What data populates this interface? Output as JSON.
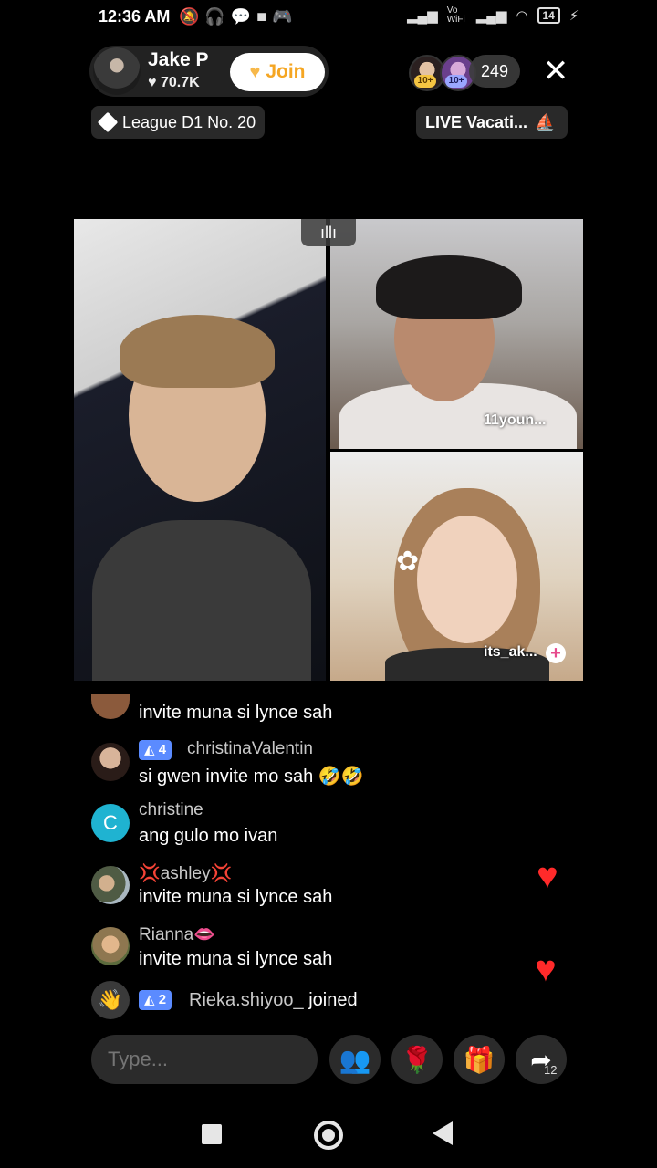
{
  "status_bar": {
    "time": "12:36 AM",
    "network_label": "Vo WiFi",
    "battery": "14",
    "left_icons": [
      "mute-icon",
      "headset-icon",
      "chat-icon",
      "video-icon",
      "game-icon"
    ],
    "right_icons": [
      "signal-icon",
      "wifi-icon",
      "battery-icon",
      "charging-icon"
    ]
  },
  "host": {
    "name": "Jake P",
    "likes": "70.7K",
    "join_label": "Join"
  },
  "viewers": {
    "badge1": "10+",
    "badge2": "10+",
    "count": "249"
  },
  "close_symbol": "✕",
  "league": "League D1 No. 20",
  "live_tag": "LIVE Vacati...",
  "guests": {
    "guest1": "11youn...",
    "guest2": "its_ak..."
  },
  "chat": [
    {
      "user": "",
      "message": "invite muna si lynce sah"
    },
    {
      "user": "christinaValentin",
      "level": "4",
      "message": "si gwen invite mo sah 🤣🤣"
    },
    {
      "user": "christine",
      "avatar_letter": "C",
      "message": "ang gulo mo ivan"
    },
    {
      "user": "💢ashley💢",
      "message": "invite muna si lynce sah"
    },
    {
      "user": "Rianna👄",
      "message": "invite muna si lynce sah"
    },
    {
      "user": "Rieka.shiyoo_",
      "level": "2",
      "message": "joined"
    }
  ],
  "bottom_bar": {
    "type_placeholder": "Type...",
    "share_count": "12"
  },
  "colors": {
    "join_text": "#f5a623",
    "level_badge": "#5b8bff",
    "heart": "#ff2a2a"
  }
}
